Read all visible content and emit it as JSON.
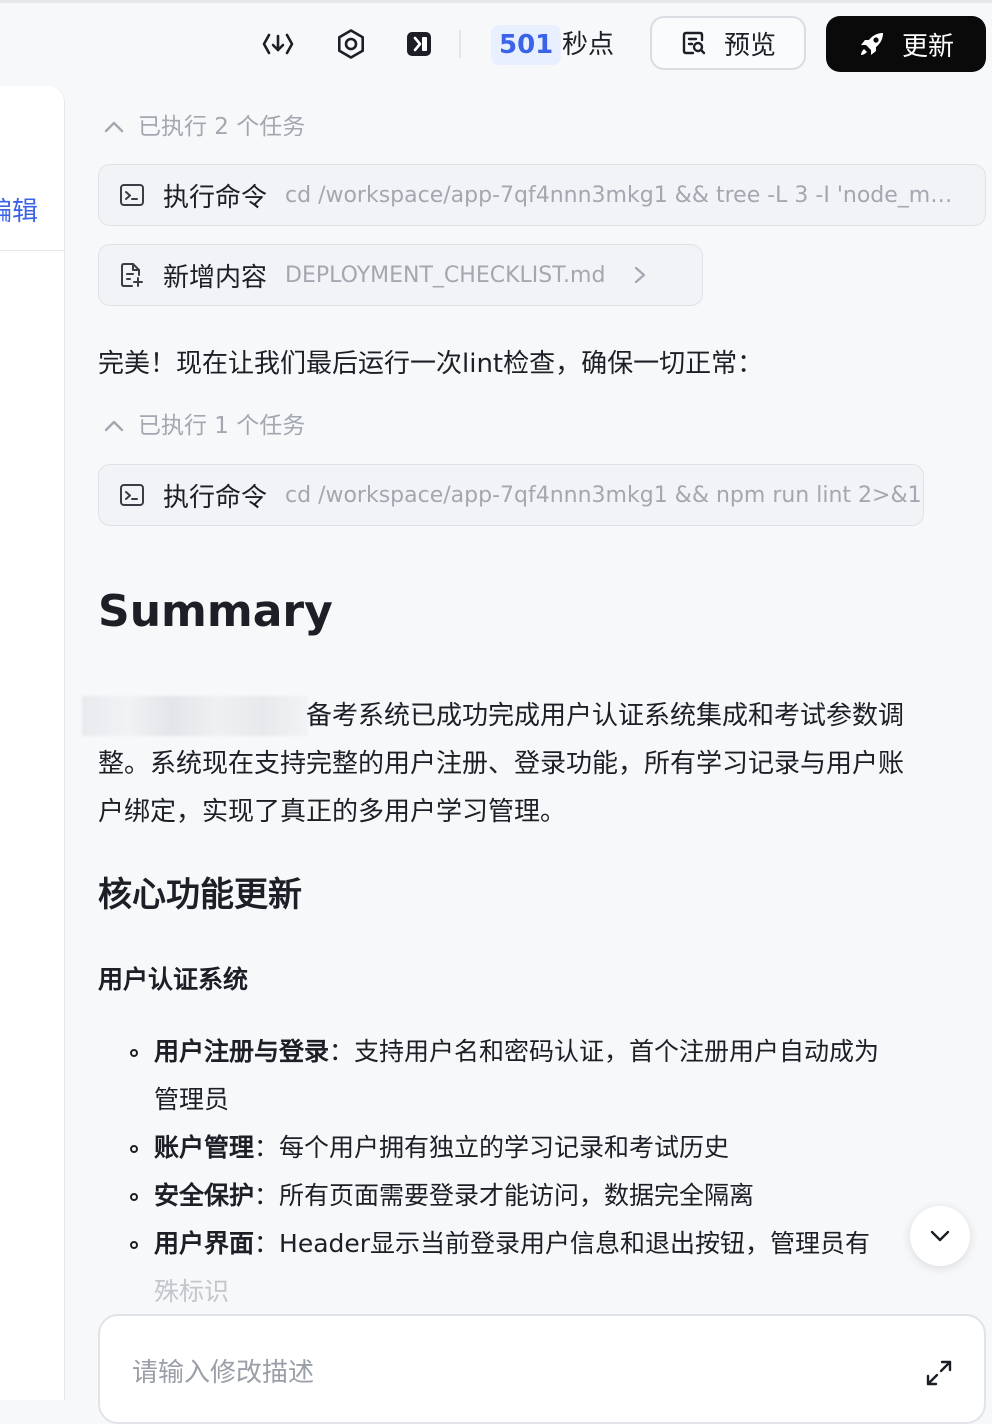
{
  "toolbar": {
    "points_value": "501",
    "points_label": "秒点",
    "preview_label": "预览",
    "update_label": "更新"
  },
  "left_panel": {
    "edit_label": "编辑"
  },
  "chat": {
    "task_group_1": "已执行 2 个任务",
    "cmd_1_label": "执行命令",
    "cmd_1_detail": "cd /workspace/app-7qf4nnn3mkg1 && tree -L 3 -I 'node_mo…",
    "file_1_label": "新增内容",
    "file_1_detail": "DEPLOYMENT_CHECKLIST.md",
    "message_1": "完美！现在让我们最后运行一次lint检查，确保一切正常：",
    "task_group_2": "已执行 1 个任务",
    "cmd_2_label": "执行命令",
    "cmd_2_detail": "cd /workspace/app-7qf4nnn3mkg1 && npm run lint 2>&1",
    "summary_title": "Summary",
    "summary_line_1": "备考系统已成功完成用户认证系统集成和考试参数调",
    "summary_line_2": "整。系统现在支持完整的用户注册、登录功能，所有学习记录与用户账",
    "summary_line_3": "户绑定，实现了真正的多用户学习管理。",
    "section_title": "核心功能更新",
    "subsection_title": "用户认证系统",
    "bullets": [
      {
        "title": "用户注册与登录",
        "line_1": "：支持用户名和密码认证，首个注册用户自动成为",
        "line_2": "管理员"
      },
      {
        "title": "账户管理",
        "line_1": "：每个用户拥有独立的学习记录和考试历史"
      },
      {
        "title": "安全保护",
        "line_1": "：所有页面需要登录才能访问，数据完全隔离"
      },
      {
        "title": "用户界面",
        "line_1": "：Header显示当前登录用户信息和退出按钮，管理员有",
        "line_2": "殊标识"
      }
    ]
  },
  "input": {
    "placeholder": "请输入修改描述"
  }
}
